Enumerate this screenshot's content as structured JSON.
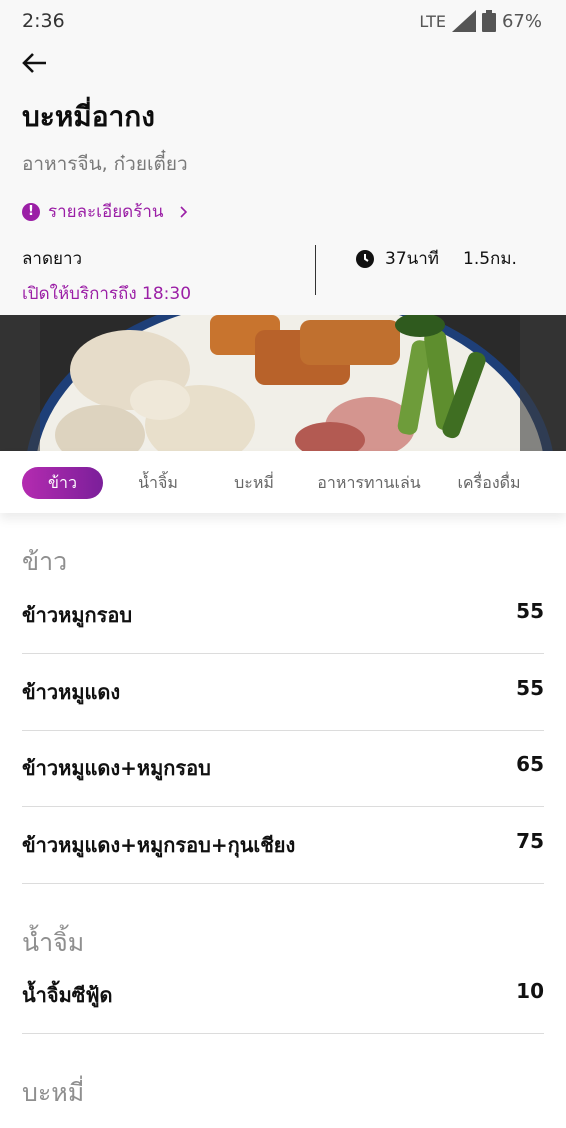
{
  "status_bar": {
    "time": "2:36",
    "network": "LTE",
    "battery": "67%"
  },
  "header": {
    "title": "บะหมี่อากง",
    "subtitle": "อาหารจีน, ก๋วยเตี๋ยว",
    "details_link": "รายละเอียดร้าน",
    "location": "ลาดยาว",
    "hours": "เปิดให้บริการถึง 18:30",
    "eta": "37นาที",
    "distance": "1.5กม."
  },
  "tabs": [
    {
      "label": "ข้าว",
      "active": true
    },
    {
      "label": "น้ำจิ้ม",
      "active": false
    },
    {
      "label": "บะหมี่",
      "active": false
    },
    {
      "label": "อาหารทานเล่น",
      "active": false
    },
    {
      "label": "เครื่องดื่ม",
      "active": false
    }
  ],
  "menu": {
    "rice": {
      "title": "ข้าว",
      "items": [
        {
          "name": "ข้าวหมูกรอบ",
          "price": "55"
        },
        {
          "name": "ข้าวหมูแดง",
          "price": "55"
        },
        {
          "name": "ข้าวหมูแดง+หมูกรอบ",
          "price": "65"
        },
        {
          "name": "ข้าวหมูแดง+หมูกรอบ+กุนเชียง",
          "price": "75"
        }
      ]
    },
    "sauce": {
      "title": "น้ำจิ้ม",
      "items": [
        {
          "name": "น้ำจิ้มซีฟู้ด",
          "price": "10"
        }
      ]
    },
    "noodles": {
      "title": "บะหมี่"
    }
  },
  "colors": {
    "accent": "#9b1fa6",
    "tab_gradient_start": "#b42bb0",
    "tab_gradient_end": "#7b1f9a"
  },
  "icons": [
    "back-arrow-icon",
    "signal-icon",
    "battery-icon",
    "alert-icon",
    "chevron-right-icon",
    "clock-icon"
  ]
}
